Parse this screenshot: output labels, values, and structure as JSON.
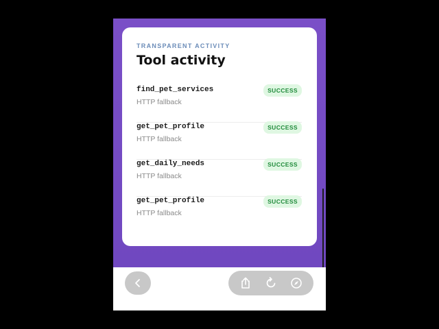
{
  "card": {
    "eyebrow": "TRANSPARENT ACTIVITY",
    "title": "Tool activity"
  },
  "tools": [
    {
      "name": "find_pet_services",
      "subtitle": "HTTP fallback",
      "status": "SUCCESS"
    },
    {
      "name": "get_pet_profile",
      "subtitle": "HTTP fallback",
      "status": "SUCCESS"
    },
    {
      "name": "get_daily_needs",
      "subtitle": "HTTP fallback",
      "status": "SUCCESS"
    },
    {
      "name": "get_pet_profile",
      "subtitle": "HTTP fallback",
      "status": "SUCCESS"
    }
  ],
  "toolbar": {
    "icons": [
      "chevron-left-icon",
      "share-icon",
      "reload-icon",
      "compass-icon"
    ]
  },
  "colors": {
    "background_purple": "#7a4fc7",
    "badge_bg": "#dff7e2",
    "badge_text": "#1f8a3a",
    "eyebrow": "#6b8cb8"
  }
}
